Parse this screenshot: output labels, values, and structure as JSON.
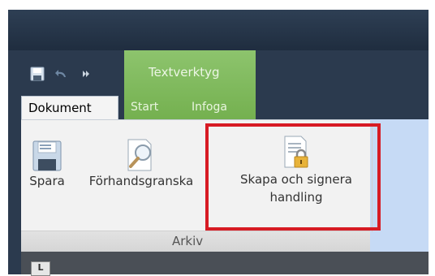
{
  "quick_access": {
    "icons": [
      "save-icon",
      "undo-icon",
      "customize-icon"
    ]
  },
  "contextual_group": {
    "title": "Textverktyg",
    "color": "#7fb95b"
  },
  "tabs": [
    {
      "label": "Dokument",
      "active": true
    },
    {
      "label": "Start",
      "active": false
    },
    {
      "label": "Infoga",
      "active": false
    }
  ],
  "ribbon": {
    "group_label": "Arkiv",
    "commands": [
      {
        "label": "Spara",
        "icon": "save-icon"
      },
      {
        "label": "Förhandsgranska",
        "icon": "print-preview-icon"
      },
      {
        "label_line1": "Skapa och signera",
        "label_line2": "handling",
        "icon": "document-lock-icon"
      }
    ]
  },
  "colors": {
    "highlight": "#d71b24",
    "title_bar": "#2b3a4e",
    "ribbon_bg": "#f2f2f2"
  },
  "small_button_label": "L"
}
